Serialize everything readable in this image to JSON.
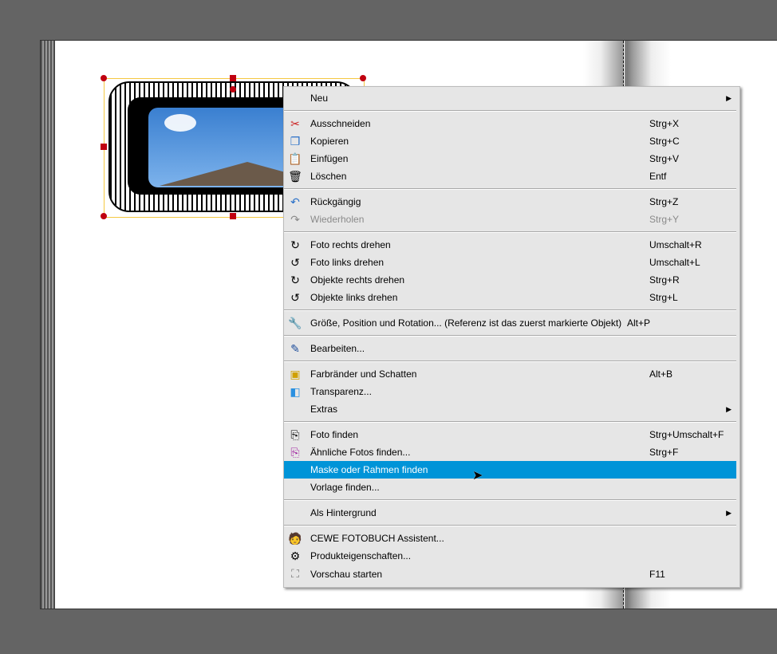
{
  "menu": {
    "neu": "Neu",
    "cut": {
      "label": "Ausschneiden",
      "shortcut": "Strg+X"
    },
    "copy": {
      "label": "Kopieren",
      "shortcut": "Strg+C"
    },
    "paste": {
      "label": "Einfügen",
      "shortcut": "Strg+V"
    },
    "delete": {
      "label": "Löschen",
      "shortcut": "Entf"
    },
    "undo": {
      "label": "Rückgängig",
      "shortcut": "Strg+Z"
    },
    "redo": {
      "label": "Wiederholen",
      "shortcut": "Strg+Y"
    },
    "photo_right": {
      "label": "Foto rechts drehen",
      "shortcut": "Umschalt+R"
    },
    "photo_left": {
      "label": "Foto links drehen",
      "shortcut": "Umschalt+L"
    },
    "obj_right": {
      "label": "Objekte rechts drehen",
      "shortcut": "Strg+R"
    },
    "obj_left": {
      "label": "Objekte links drehen",
      "shortcut": "Strg+L"
    },
    "size": {
      "label": "Größe, Position und Rotation... (Referenz ist das zuerst markierte Objekt)",
      "shortcut": "Alt+P"
    },
    "edit": {
      "label": "Bearbeiten..."
    },
    "borders": {
      "label": "Farbränder und Schatten",
      "shortcut": "Alt+B"
    },
    "transparency": {
      "label": "Transparenz..."
    },
    "extras": {
      "label": "Extras"
    },
    "find_photo": {
      "label": "Foto finden",
      "shortcut": "Strg+Umschalt+F"
    },
    "similar": {
      "label": "Ähnliche Fotos finden...",
      "shortcut": "Strg+F"
    },
    "mask": {
      "label": "Maske oder Rahmen finden"
    },
    "template": {
      "label": "Vorlage finden..."
    },
    "background": {
      "label": "Als Hintergrund"
    },
    "assistant": {
      "label": "CEWE FOTOBUCH Assistent..."
    },
    "properties": {
      "label": "Produkteigenschaften..."
    },
    "preview": {
      "label": "Vorschau starten",
      "shortcut": "F11"
    }
  },
  "colors": {
    "highlight": "#0094d8",
    "handle": "#c00010",
    "selection": "#f5c842"
  }
}
